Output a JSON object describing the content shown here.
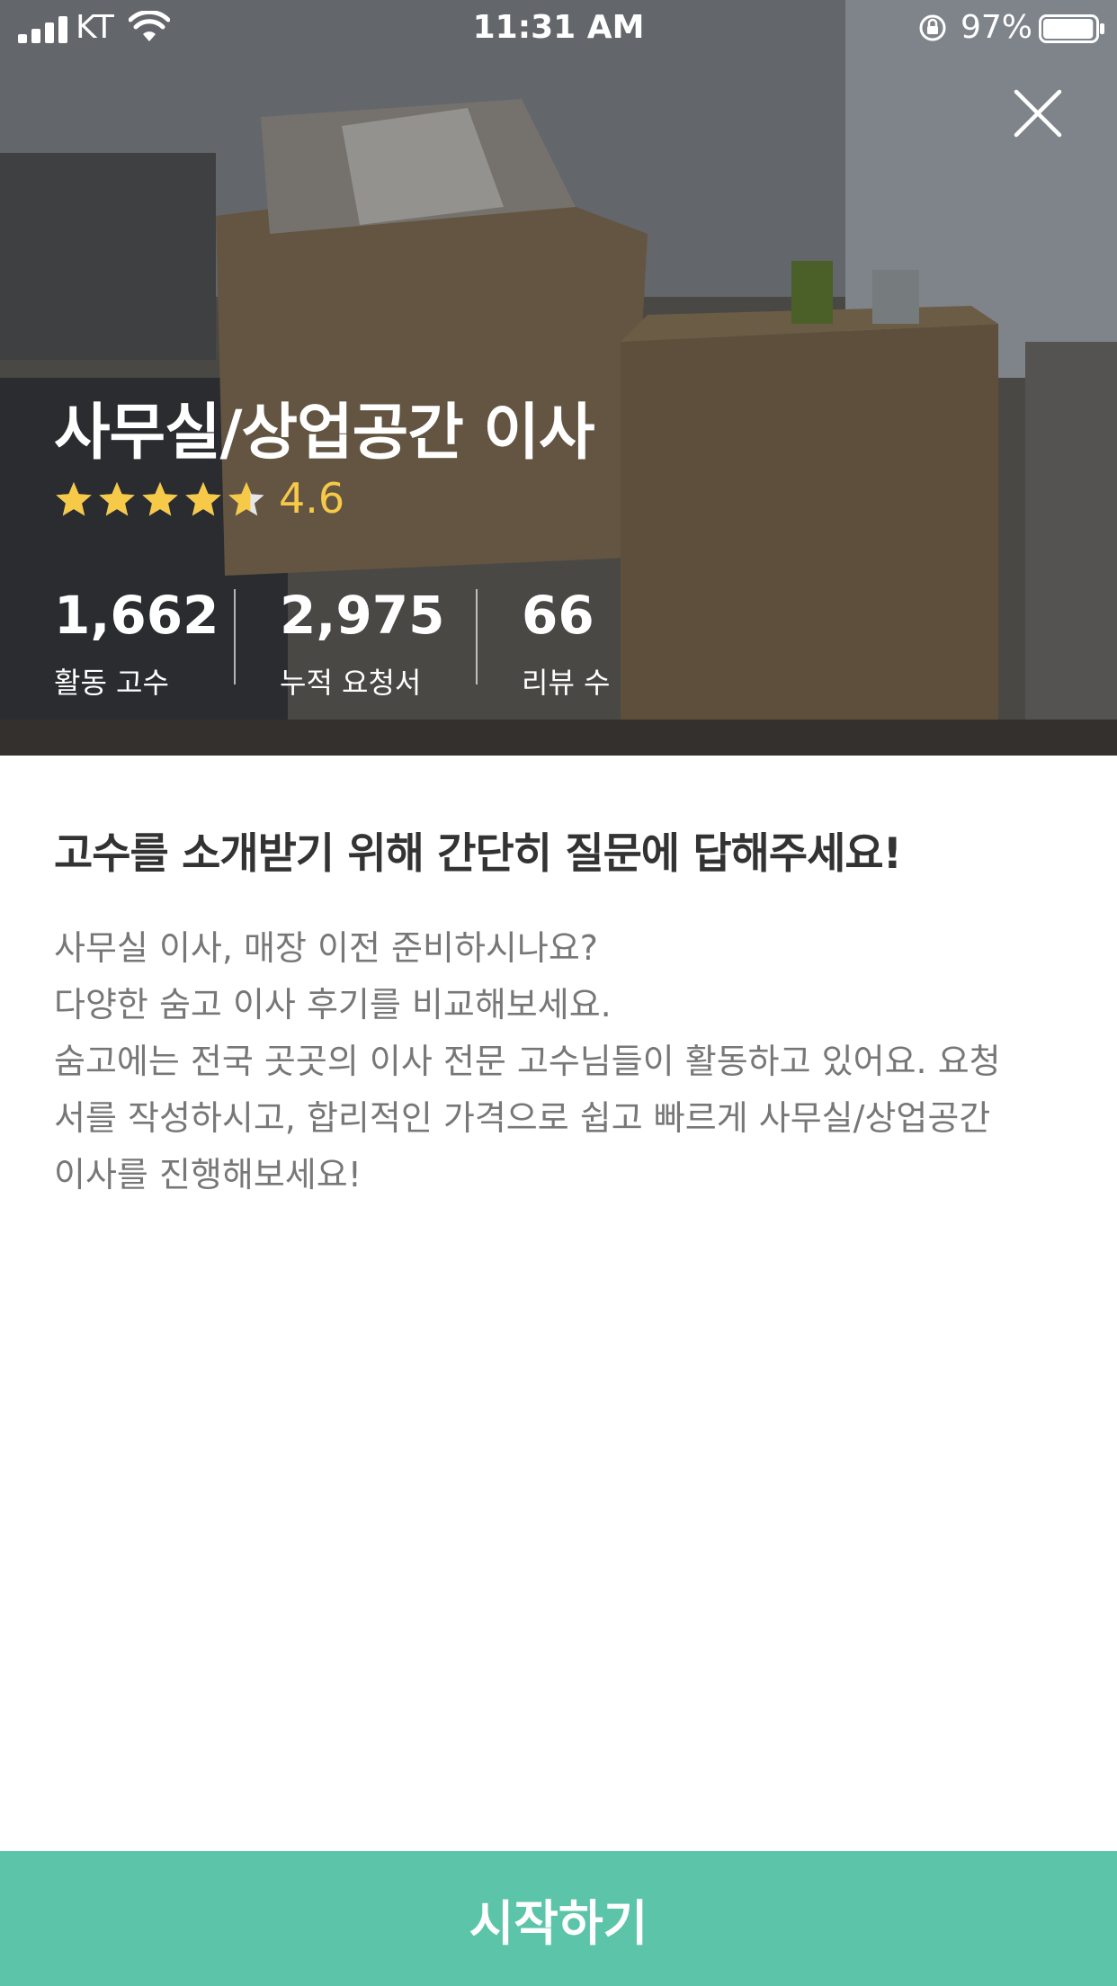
{
  "status_bar": {
    "carrier": "KT",
    "time": "11:31 AM",
    "battery_percent": "97%",
    "battery_level": 0.97
  },
  "hero": {
    "title": "사무실/상업공간 이사",
    "rating": "4.6",
    "rating_value": 4.6,
    "rating_max": 5,
    "stats": [
      {
        "value": "1,662",
        "label": "활동 고수"
      },
      {
        "value": "2,975",
        "label": "누적 요청서"
      },
      {
        "value": "66",
        "label": "리뷰 수"
      }
    ]
  },
  "content": {
    "headline": "고수를 소개받기 위해 간단히 질문에 답해주세요!",
    "description_lines": [
      "사무실 이사, 매장 이전 준비하시나요?",
      "다양한 숨고 이사 후기를 비교해보세요.",
      "숨고에는 전국 곳곳의 이사 전문 고수님들이 활동하고 있어요. 요청",
      "서를 작성하시고, 합리적인 가격으로 쉽고 빠르게 사무실/상업공간",
      "이사를 진행해보세요!"
    ]
  },
  "footer": {
    "start_label": "시작하기"
  },
  "icons": {
    "close": "close-icon",
    "star": "star-icon",
    "signal": "signal-icon",
    "wifi": "wifi-icon",
    "lock": "orientation-lock-icon",
    "battery": "battery-icon"
  },
  "colors": {
    "accent": "#5bc4a9",
    "rating": "#f7c948",
    "headline": "#333333",
    "body_text": "#777777"
  }
}
